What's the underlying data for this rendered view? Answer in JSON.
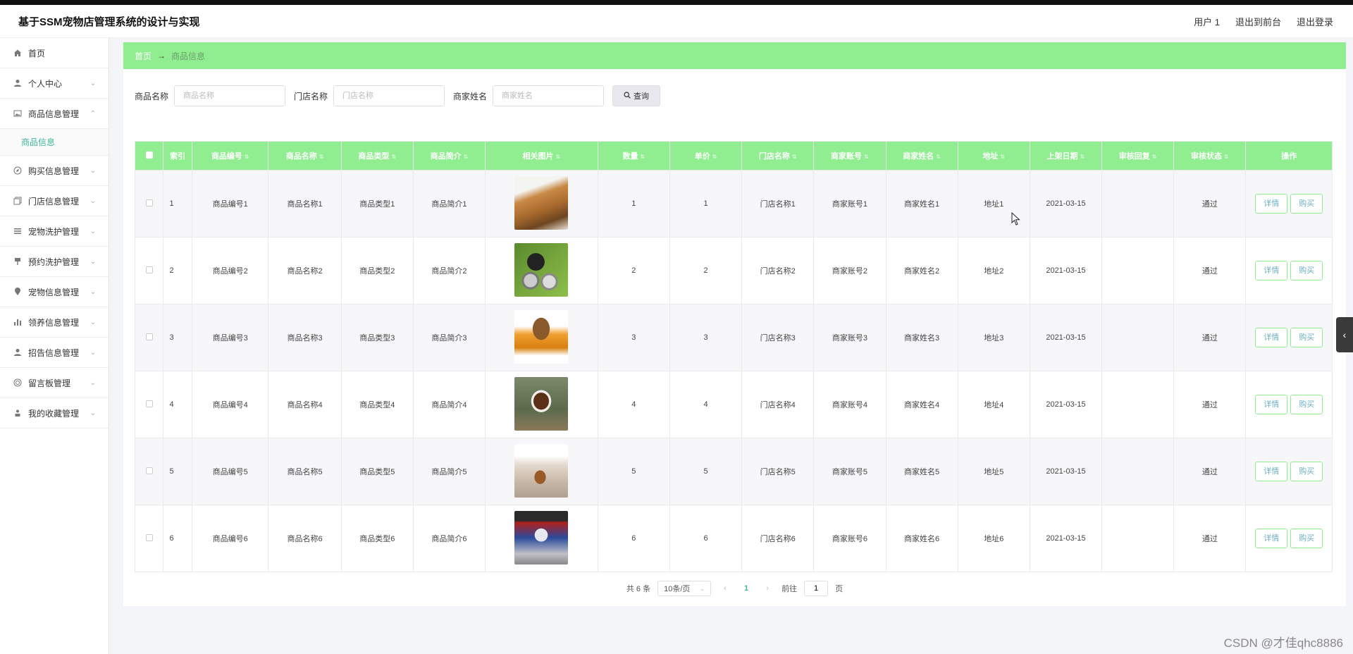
{
  "app": {
    "title": "基于SSM宠物店管理系统的设计与实现"
  },
  "header": {
    "user": "用户 1",
    "back_front": "退出到前台",
    "logout": "退出登录"
  },
  "sidebar": {
    "items": [
      {
        "label": "首页",
        "icon": "home-icon"
      },
      {
        "label": "个人中心",
        "icon": "user-icon"
      },
      {
        "label": "商品信息管理",
        "icon": "image-icon",
        "sub": "商品信息"
      },
      {
        "label": "购买信息管理",
        "icon": "compass-icon"
      },
      {
        "label": "门店信息管理",
        "icon": "copy-icon"
      },
      {
        "label": "宠物洗护管理",
        "icon": "list-icon"
      },
      {
        "label": "预约洗护管理",
        "icon": "pin-icon"
      },
      {
        "label": "宠物信息管理",
        "icon": "location-icon"
      },
      {
        "label": "领养信息管理",
        "icon": "chart-icon"
      },
      {
        "label": "招告信息管理",
        "icon": "person-icon"
      },
      {
        "label": "留言板管理",
        "icon": "target-icon"
      },
      {
        "label": "我的收藏管理",
        "icon": "bookmark-user-icon"
      }
    ]
  },
  "breadcrumb": {
    "home": "首页",
    "arrow": "→",
    "current": "商品信息"
  },
  "search": {
    "name_label": "商品名称",
    "name_placeholder": "商品名称",
    "store_label": "门店名称",
    "store_placeholder": "门店名称",
    "merchant_label": "商家姓名",
    "merchant_placeholder": "商家姓名",
    "button": "查询"
  },
  "table": {
    "headers": [
      "索引",
      "商品编号",
      "商品名称",
      "商品类型",
      "商品简介",
      "相关图片",
      "数量",
      "单价",
      "门店名称",
      "商家账号",
      "商家姓名",
      "地址",
      "上架日期",
      "审核回复",
      "审核状态",
      "操作"
    ],
    "rows": [
      {
        "idx": "1",
        "code": "商品编号1",
        "name": "商品名称1",
        "type": "商品类型1",
        "intro": "商品简介1",
        "qty": "1",
        "price": "1",
        "store": "门店名称1",
        "account": "商家账号1",
        "merchant": "商家姓名1",
        "addr": "地址1",
        "date": "2021-03-15",
        "reply": "",
        "status": "通过"
      },
      {
        "idx": "2",
        "code": "商品编号2",
        "name": "商品名称2",
        "type": "商品类型2",
        "intro": "商品简介2",
        "qty": "2",
        "price": "2",
        "store": "门店名称2",
        "account": "商家账号2",
        "merchant": "商家姓名2",
        "addr": "地址2",
        "date": "2021-03-15",
        "reply": "",
        "status": "通过"
      },
      {
        "idx": "3",
        "code": "商品编号3",
        "name": "商品名称3",
        "type": "商品类型3",
        "intro": "商品简介3",
        "qty": "3",
        "price": "3",
        "store": "门店名称3",
        "account": "商家账号3",
        "merchant": "商家姓名3",
        "addr": "地址3",
        "date": "2021-03-15",
        "reply": "",
        "status": "通过"
      },
      {
        "idx": "4",
        "code": "商品编号4",
        "name": "商品名称4",
        "type": "商品类型4",
        "intro": "商品简介4",
        "qty": "4",
        "price": "4",
        "store": "门店名称4",
        "account": "商家账号4",
        "merchant": "商家姓名4",
        "addr": "地址4",
        "date": "2021-03-15",
        "reply": "",
        "status": "通过"
      },
      {
        "idx": "5",
        "code": "商品编号5",
        "name": "商品名称5",
        "type": "商品类型5",
        "intro": "商品简介5",
        "qty": "5",
        "price": "5",
        "store": "门店名称5",
        "account": "商家账号5",
        "merchant": "商家姓名5",
        "addr": "地址5",
        "date": "2021-03-15",
        "reply": "",
        "status": "通过"
      },
      {
        "idx": "6",
        "code": "商品编号6",
        "name": "商品名称6",
        "type": "商品类型6",
        "intro": "商品简介6",
        "qty": "6",
        "price": "6",
        "store": "门店名称6",
        "account": "商家账号6",
        "merchant": "商家姓名6",
        "addr": "地址6",
        "date": "2021-03-15",
        "reply": "",
        "status": "通过"
      }
    ],
    "detail_btn": "详情",
    "buy_btn": "购买"
  },
  "pager": {
    "total": "共 6 条",
    "page_size": "10条/页",
    "current": "1",
    "goto_prefix": "前往",
    "goto_value": "1",
    "goto_suffix": "页"
  },
  "watermark": "CSDN @才佳qhc8886",
  "colors": {
    "accent_green": "#90ee90",
    "link_teal": "#3cb79a"
  }
}
